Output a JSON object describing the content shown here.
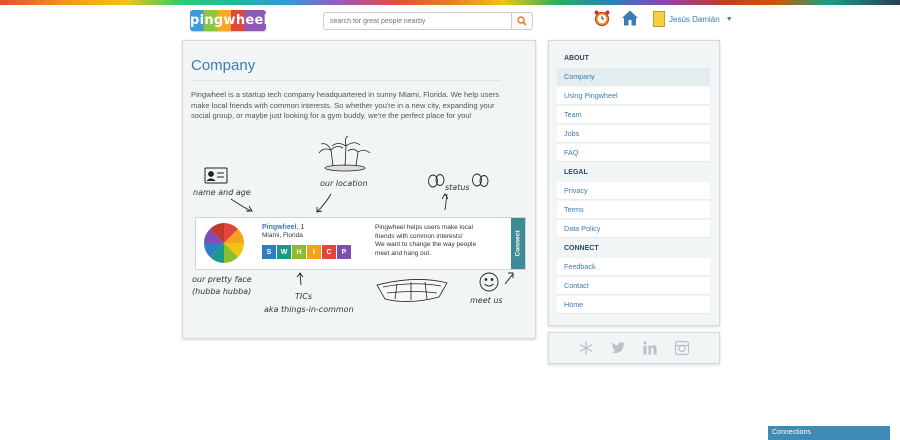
{
  "header": {
    "logo_text": "pingwheel",
    "search_placeholder": "search for great people nearby",
    "user_name": "Jesús Damián",
    "icons": [
      "search-icon",
      "alarm-icon",
      "home-icon",
      "chevron-down-icon"
    ]
  },
  "main": {
    "title": "Company",
    "body": "Pingwheel is a startup tech company headquartered in sunny Miami, Florida. We help users make local friends with common interests. So whether you're in a new city, expanding your social group, or maybe just looking for a gym buddy, we're the perfect place for you!",
    "annotations": {
      "name_age": "name and age",
      "location": "our location",
      "status": "status",
      "face_1": "our pretty face",
      "face_2": "(hubba hubba)",
      "tics_1": "TICs",
      "tics_2": "aka things-in-common",
      "meet": "meet us"
    },
    "card": {
      "name": "Pingwheel",
      "age": ", 1",
      "location": "Miami, Florida",
      "tics": [
        "S",
        "W",
        "H",
        "I",
        "C",
        "P"
      ],
      "tic_colors": [
        "#2e7fc2",
        "#1a9a8a",
        "#8bbd2f",
        "#f2a31b",
        "#e2453b",
        "#7d4fb1"
      ],
      "bio_1": "Pingwheel helps users make local",
      "bio_2": "friends with common interests!",
      "bio_3": "We want to change the way people",
      "bio_4": "meet and hang out.",
      "connect_label": "Connect"
    }
  },
  "sidebar": {
    "about_header": "ABOUT",
    "about_items": [
      "Company",
      "Using Pingwheel",
      "Team",
      "Jobs",
      "FAQ"
    ],
    "legal_header": "LEGAL",
    "legal_items": [
      "Privacy",
      "Terms",
      "Data Policy"
    ],
    "connect_header": "CONNECT",
    "connect_items": [
      "Feedback",
      "Contact",
      "Home"
    ],
    "active_item": "Company"
  },
  "social_icons": [
    "snowflake-icon",
    "twitter-icon",
    "linkedin-icon",
    "instagram-icon"
  ],
  "footer": {
    "connections_label": "Connections"
  },
  "colors": {
    "accent": "#3d7bb4",
    "connect": "#3e8b98",
    "panel": "#f2f5f6"
  }
}
